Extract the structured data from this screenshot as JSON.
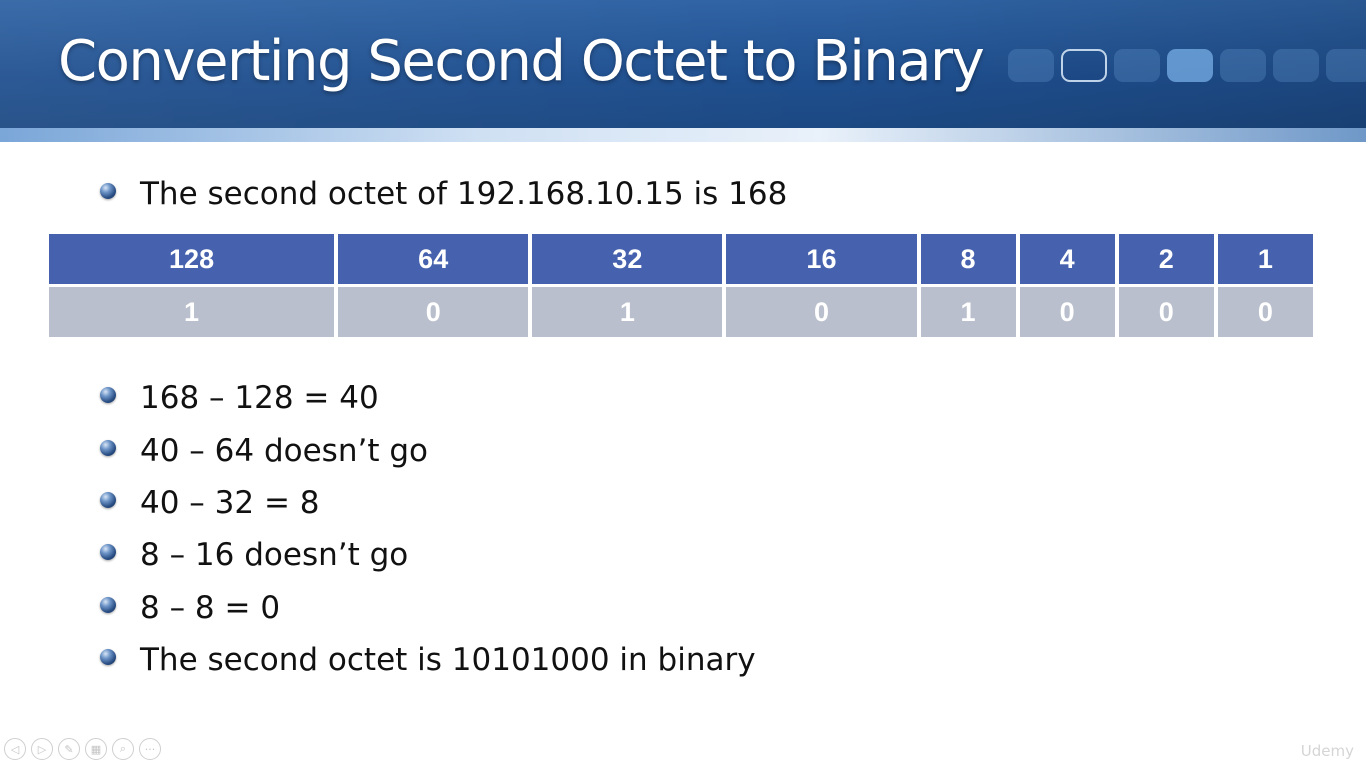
{
  "slide": {
    "title": "Converting Second Octet to Binary",
    "intro_bullet": "The second octet of 192.168.10.15 is 168",
    "table": {
      "place_values": [
        "128",
        "64",
        "32",
        "16",
        "8",
        "4",
        "2",
        "1"
      ],
      "bits": [
        "1",
        "0",
        "1",
        "0",
        "1",
        "0",
        "0",
        "0"
      ]
    },
    "steps": [
      "168 – 128 = 40",
      "40 – 64 doesn’t go",
      "40 – 32 = 8",
      "8 – 16 doesn’t go",
      "8 – 8 = 0",
      "The second octet is 10101000 in binary"
    ]
  },
  "controls": {
    "prev_icon": "◁",
    "next_icon": "▷",
    "pen_icon": "✎",
    "slides_icon": "▦",
    "zoom_icon": "⌕",
    "more_icon": "···"
  },
  "watermark": "Udemy",
  "colors": {
    "header_blue": "#1f4f8f",
    "table_header": "#4661ad",
    "table_value": "#b9bfcc"
  }
}
